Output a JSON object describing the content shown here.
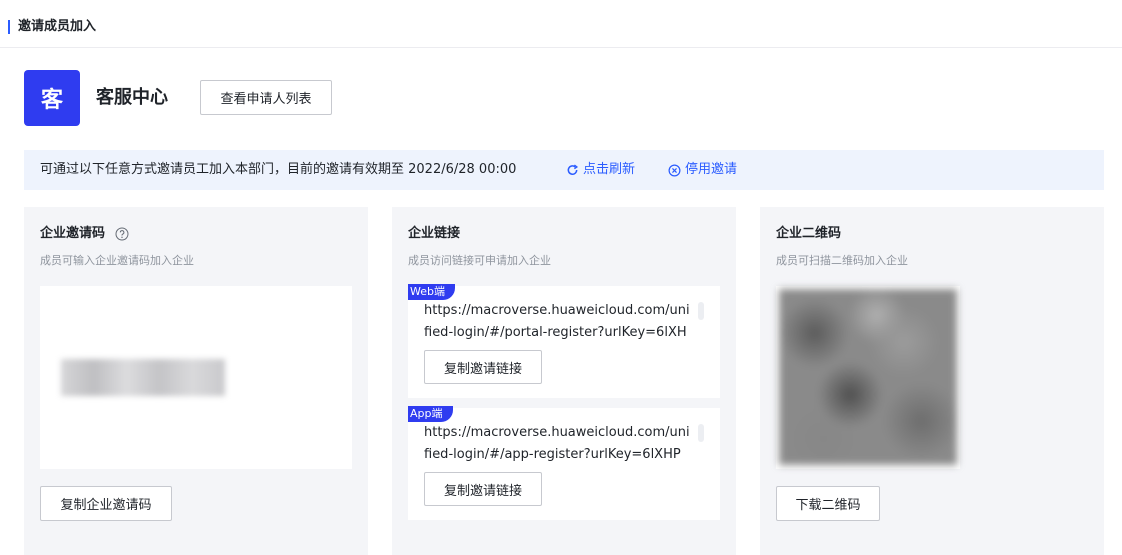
{
  "header": {
    "title": "邀请成员加入"
  },
  "department": {
    "avatar_char": "客",
    "name": "客服中心",
    "view_applicants_label": "查看申请人列表"
  },
  "notice": {
    "text": "可通过以下任意方式邀请员工加入本部门，目前的邀请有效期至 2022/6/28 00:00",
    "refresh_label": "点击刷新",
    "disable_label": "停用邀请"
  },
  "invite_code": {
    "title": "企业邀请码",
    "subtitle": "成员可输入企业邀请码加入企业",
    "copy_label": "复制企业邀请码"
  },
  "invite_link": {
    "title": "企业链接",
    "subtitle": "成员访问链接可申请加入企业",
    "web": {
      "tag": "Web端",
      "line1": "https://macroverse.huaweicloud.com/uni",
      "line2": "fied-login/#/portal-register?urlKey=6lXH",
      "copy_label": "复制邀请链接"
    },
    "app": {
      "tag": "App端",
      "line1": "https://macroverse.huaweicloud.com/uni",
      "line2": "fied-login/#/app-register?urlKey=6lXHP",
      "copy_label": "复制邀请链接"
    }
  },
  "qr": {
    "title": "企业二维码",
    "subtitle": "成员可扫描二维码加入企业",
    "download_label": "下载二维码"
  },
  "colors": {
    "accent": "#2b5cff",
    "tag": "#2f3cf0",
    "notice_bg": "#eef3fd",
    "card_bg": "#f4f5f8"
  }
}
